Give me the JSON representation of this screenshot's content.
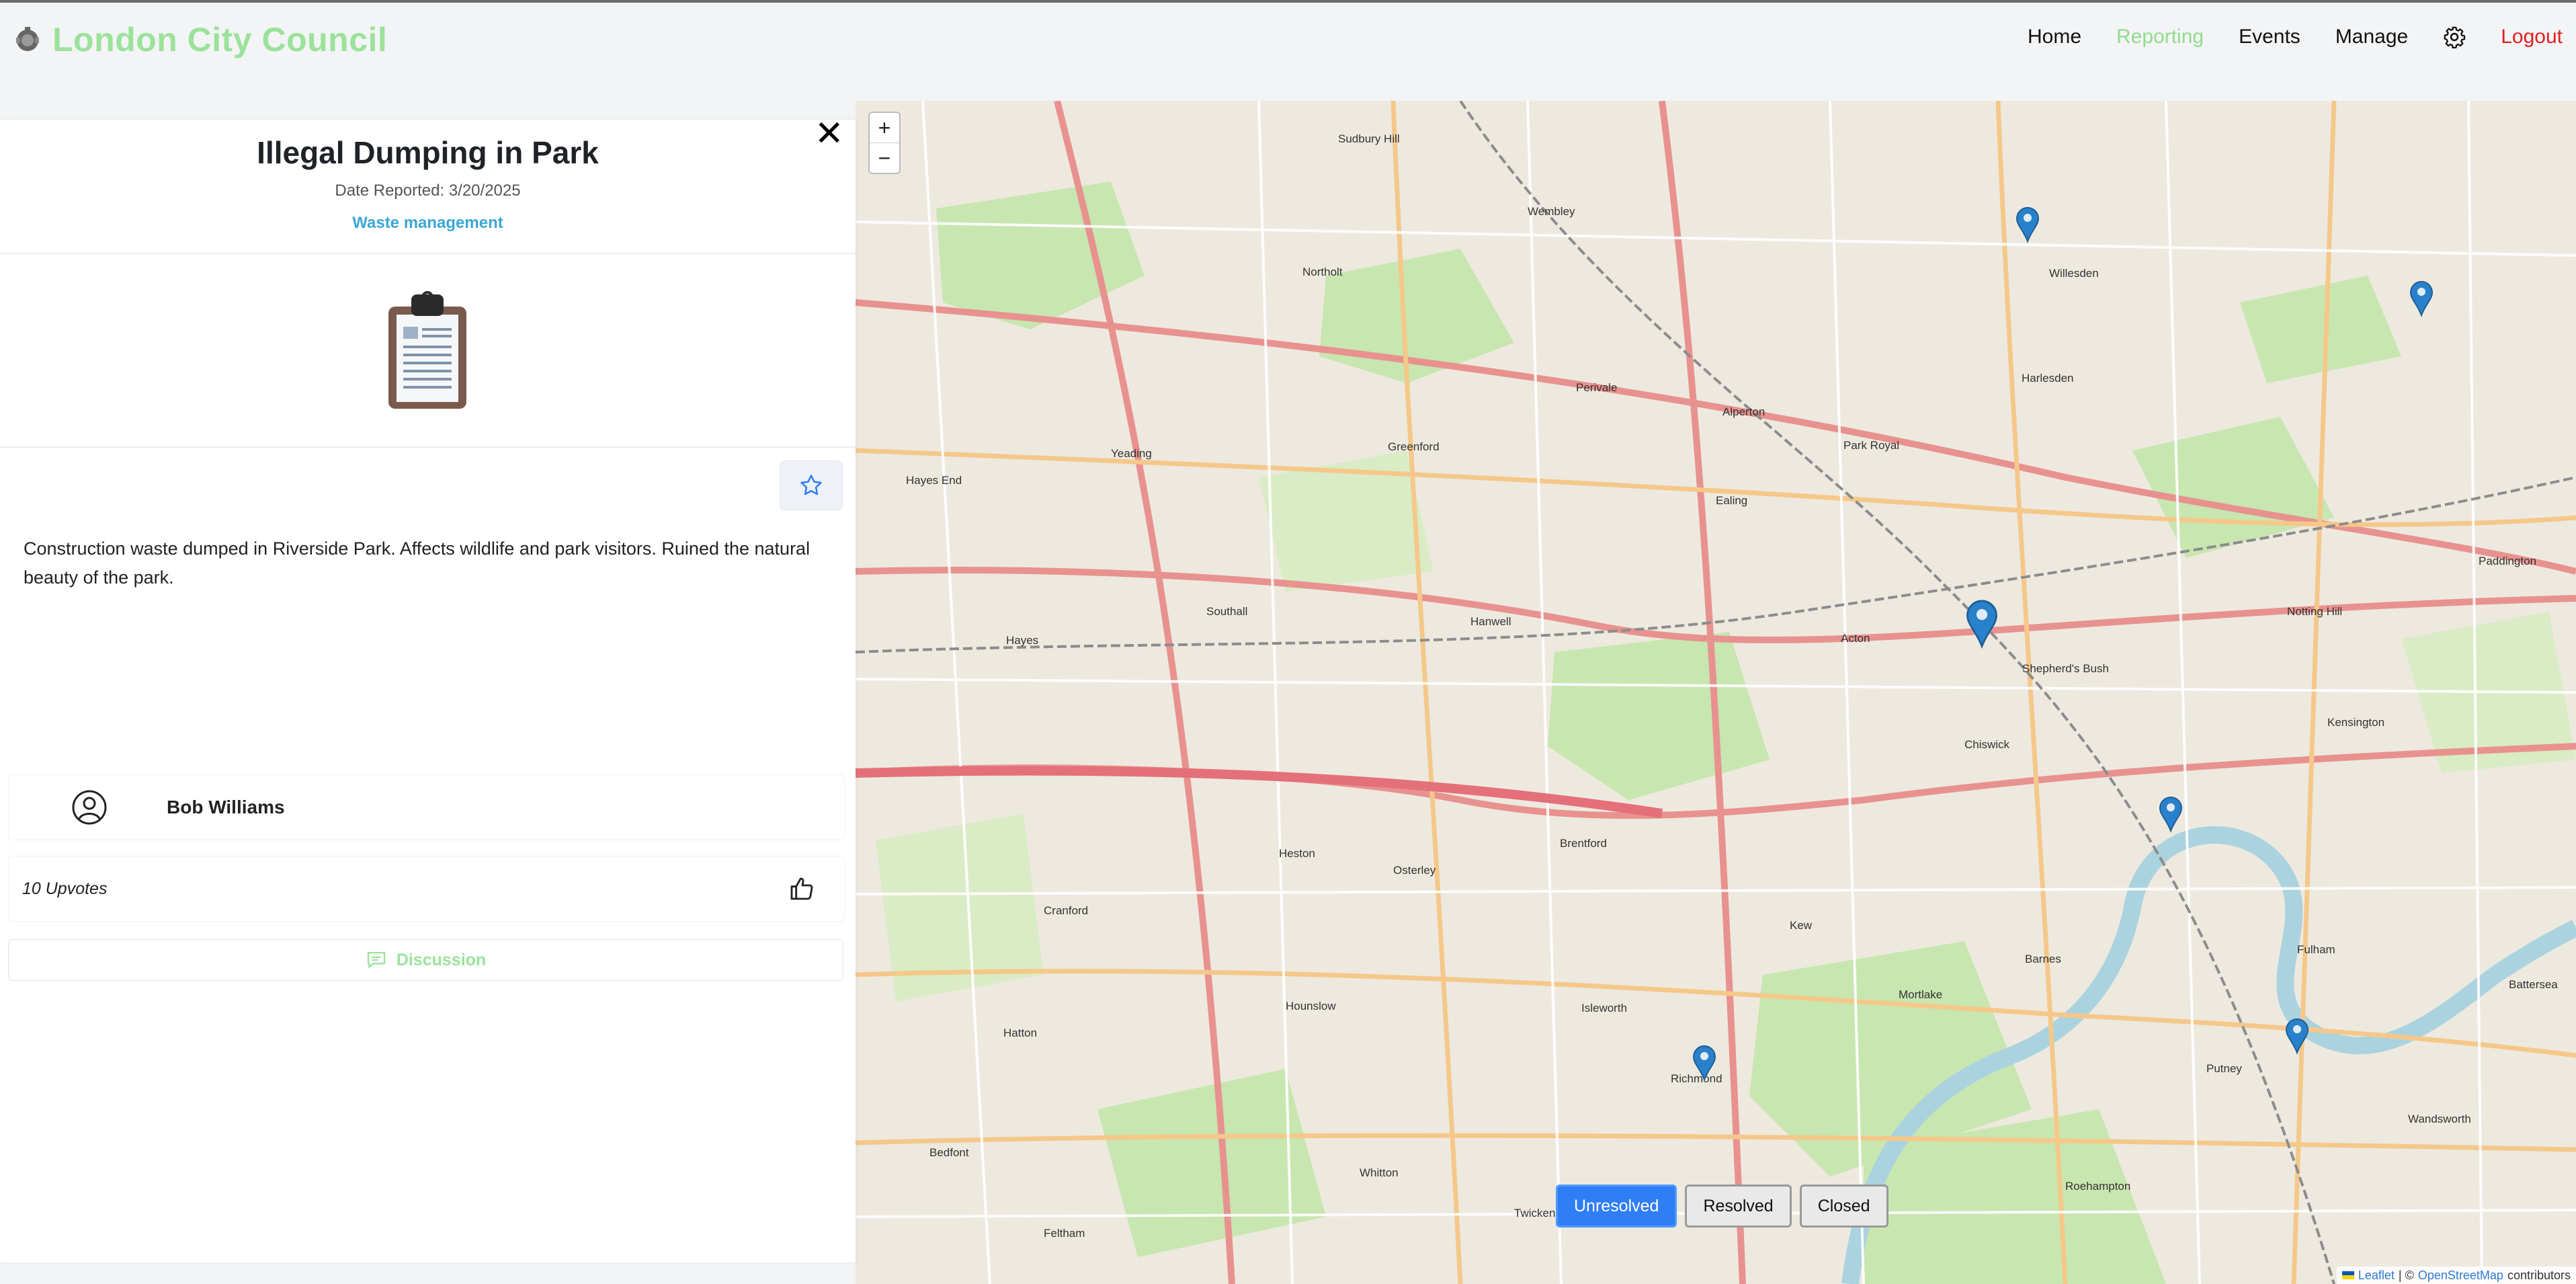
{
  "header": {
    "brand": "London City Council",
    "nav": [
      {
        "label": "Home",
        "active": false
      },
      {
        "label": "Reporting",
        "active": true
      },
      {
        "label": "Events",
        "active": false
      },
      {
        "label": "Manage",
        "active": false
      }
    ],
    "settings_icon": "gear-icon",
    "logout": "Logout",
    "colors": {
      "brand": "#9be29b",
      "active": "#8fdc8f",
      "logout": "#e0201f"
    }
  },
  "report": {
    "close_symbol": "✕",
    "title": "Illegal Dumping in Park",
    "date_reported": "Date Reported: 3/20/2025",
    "category": "Waste management",
    "image_icon": "clipboard-icon",
    "favorite_icon": "star-icon",
    "description": "Construction waste dumped in Riverside Park. Affects wildlife and park visitors. Ruined the natural beauty of the park.",
    "author": "Bob Williams",
    "upvotes": "10 Upvotes",
    "discussion_label": "Discussion"
  },
  "map": {
    "zoom_in": "+",
    "zoom_out": "−",
    "place_labels": [
      "Sudbury Hill",
      "Wembley",
      "Willesden",
      "Northolt",
      "Harlesden",
      "Perivale",
      "Alperton",
      "Greenford",
      "Park Royal",
      "Yeading",
      "Ealing",
      "Hayes End",
      "Southall",
      "Hanwell",
      "Acton",
      "Hayes",
      "Shepherd's Bush",
      "Notting Hill",
      "Chiswick",
      "Brentford",
      "Heston",
      "Osterley",
      "Hounslow",
      "Kew",
      "Barnes",
      "Fulham",
      "Putney",
      "Isleworth",
      "Richmond",
      "Twickenham",
      "Mortlake",
      "Kensington",
      "Paddington",
      "Battersea",
      "Wandsworth",
      "Bedfont",
      "Feltham",
      "Whitton",
      "Cranford",
      "Hatton",
      "Roehampton"
    ],
    "filters": [
      {
        "label": "Unresolved",
        "active": true
      },
      {
        "label": "Resolved",
        "active": false
      },
      {
        "label": "Closed",
        "active": false
      }
    ],
    "attribution": {
      "leaflet": "Leaflet",
      "separator": "| ©",
      "osm": "OpenStreetMap",
      "suffix": "contributors"
    }
  }
}
